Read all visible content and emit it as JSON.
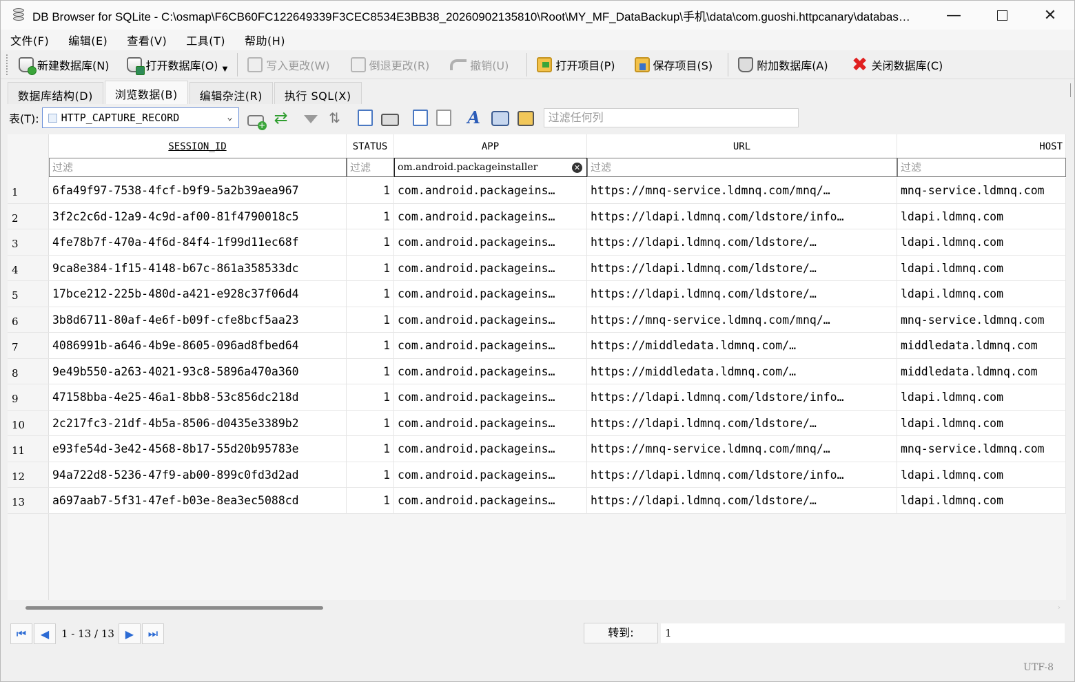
{
  "window": {
    "title": "DB Browser for SQLite - C:\\osmap\\F6CB60FC122649339F3CEC8534E3BB38_20260902135810\\Root\\MY_MF_DataBackup\\手机\\data\\com.guoshi.httpcanary\\databas…",
    "minimize": "—",
    "close": "✕"
  },
  "menu": [
    "文件(F)",
    "编辑(E)",
    "查看(V)",
    "工具(T)",
    "帮助(H)"
  ],
  "toolbar": {
    "new_db": "新建数据库(N)",
    "open_db": "打开数据库(O)",
    "write_changes": "写入更改(W)",
    "revert_changes": "倒退更改(R)",
    "undo": "撤销(U)",
    "open_project": "打开项目(P)",
    "save_project": "保存项目(S)",
    "attach_db": "附加数据库(A)",
    "close_db": "关闭数据库(C)"
  },
  "tabs": [
    "数据库结构(D)",
    "浏览数据(B)",
    "编辑杂注(R)",
    "执行 SQL(X)"
  ],
  "browse": {
    "table_label": "表(T):",
    "table_name": "HTTP_CAPTURE_RECORD",
    "filter_any_placeholder": "过滤任何列",
    "columns": [
      "SESSION_ID",
      "STATUS",
      "APP",
      "URL",
      "HOST"
    ],
    "filter_placeholder": "过滤",
    "app_filter_value": "om.android.packageinstaller",
    "rows": [
      {
        "n": "1",
        "sid": "6fa49f97-7538-4fcf-b9f9-5a2b39aea967",
        "status": "1",
        "app": "com.android.packageins…",
        "url": "https://mnq-service.ldmnq.com/mnq/…",
        "host": "mnq-service.ldmnq.com"
      },
      {
        "n": "2",
        "sid": "3f2c2c6d-12a9-4c9d-af00-81f4790018c5",
        "status": "1",
        "app": "com.android.packageins…",
        "url": "https://ldapi.ldmnq.com/ldstore/info…",
        "host": "ldapi.ldmnq.com"
      },
      {
        "n": "3",
        "sid": "4fe78b7f-470a-4f6d-84f4-1f99d11ec68f",
        "status": "1",
        "app": "com.android.packageins…",
        "url": "https://ldapi.ldmnq.com/ldstore/…",
        "host": "ldapi.ldmnq.com"
      },
      {
        "n": "4",
        "sid": "9ca8e384-1f15-4148-b67c-861a358533dc",
        "status": "1",
        "app": "com.android.packageins…",
        "url": "https://ldapi.ldmnq.com/ldstore/…",
        "host": "ldapi.ldmnq.com"
      },
      {
        "n": "5",
        "sid": "17bce212-225b-480d-a421-e928c37f06d4",
        "status": "1",
        "app": "com.android.packageins…",
        "url": "https://ldapi.ldmnq.com/ldstore/…",
        "host": "ldapi.ldmnq.com"
      },
      {
        "n": "6",
        "sid": "3b8d6711-80af-4e6f-b09f-cfe8bcf5aa23",
        "status": "1",
        "app": "com.android.packageins…",
        "url": "https://mnq-service.ldmnq.com/mnq/…",
        "host": "mnq-service.ldmnq.com"
      },
      {
        "n": "7",
        "sid": "4086991b-a646-4b9e-8605-096ad8fbed64",
        "status": "1",
        "app": "com.android.packageins…",
        "url": "https://middledata.ldmnq.com/…",
        "host": "middledata.ldmnq.com"
      },
      {
        "n": "8",
        "sid": "9e49b550-a263-4021-93c8-5896a470a360",
        "status": "1",
        "app": "com.android.packageins…",
        "url": "https://middledata.ldmnq.com/…",
        "host": "middledata.ldmnq.com"
      },
      {
        "n": "9",
        "sid": "47158bba-4e25-46a1-8bb8-53c856dc218d",
        "status": "1",
        "app": "com.android.packageins…",
        "url": "https://ldapi.ldmnq.com/ldstore/info…",
        "host": "ldapi.ldmnq.com"
      },
      {
        "n": "10",
        "sid": "2c217fc3-21df-4b5a-8506-d0435e3389b2",
        "status": "1",
        "app": "com.android.packageins…",
        "url": "https://ldapi.ldmnq.com/ldstore/…",
        "host": "ldapi.ldmnq.com"
      },
      {
        "n": "11",
        "sid": "e93fe54d-3e42-4568-8b17-55d20b95783e",
        "status": "1",
        "app": "com.android.packageins…",
        "url": "https://mnq-service.ldmnq.com/mnq/…",
        "host": "mnq-service.ldmnq.com"
      },
      {
        "n": "12",
        "sid": "94a722d8-5236-47f9-ab00-899c0fd3d2ad",
        "status": "1",
        "app": "com.android.packageins…",
        "url": "https://ldapi.ldmnq.com/ldstore/info…",
        "host": "ldapi.ldmnq.com"
      },
      {
        "n": "13",
        "sid": "a697aab7-5f31-47ef-b03e-8ea3ec5088cd",
        "status": "1",
        "app": "com.android.packageins…",
        "url": "https://ldapi.ldmnq.com/ldstore/…",
        "host": "ldapi.ldmnq.com"
      }
    ]
  },
  "pager": {
    "range": "1 - 13 / 13",
    "goto_label": "转到:",
    "goto_value": "1"
  },
  "status": {
    "encoding": "UTF-8"
  },
  "icons": [
    "app-db-icon",
    "new-db-icon",
    "open-db-icon",
    "write-icon",
    "revert-icon",
    "undo-icon",
    "open-project-icon",
    "save-project-icon",
    "attach-db-icon",
    "close-db-icon",
    "insert-record-icon",
    "refresh-icon",
    "clear-filters-icon",
    "sort-icon",
    "save-results-icon",
    "print-icon",
    "import-icon",
    "export-icon",
    "font-icon",
    "find-icon",
    "replace-icon",
    "first-page-icon",
    "prev-page-icon",
    "next-page-icon",
    "last-page-icon"
  ]
}
